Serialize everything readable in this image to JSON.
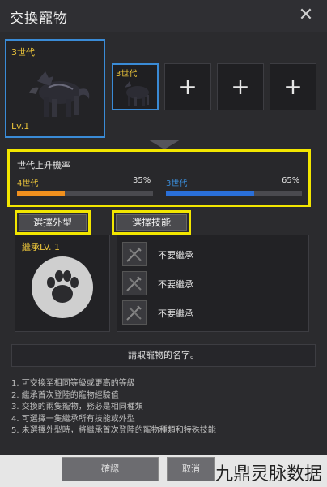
{
  "window": {
    "title": "交換寵物",
    "close_glyph": "✕"
  },
  "slots": {
    "main": {
      "generation": "3世代",
      "level": "Lv.1"
    },
    "secondary": {
      "generation": "3世代"
    },
    "add_glyph": "+"
  },
  "rate": {
    "title": "世代上升機率",
    "left": {
      "label": "4世代",
      "percent": "35%",
      "value": 35,
      "color": "#f0901e"
    },
    "right": {
      "label": "3世代",
      "percent": "65%",
      "value": 65,
      "color": "#2a6fd8"
    }
  },
  "buttons": {
    "appearance": "選擇外型",
    "skills": "選擇技能"
  },
  "inherit": {
    "level_label": "繼承LV. 1"
  },
  "skills": [
    {
      "text": "不要繼承",
      "icon": "sword-icon"
    },
    {
      "text": "不要繼承",
      "icon": "sword-icon"
    },
    {
      "text": "不要繼承",
      "icon": "sword-icon"
    }
  ],
  "name_field": {
    "placeholder": "請取寵物的名字。"
  },
  "notes": [
    "1. 可交換至相同等級或更高的等級",
    "2. 繼承首次登陸的寵物經驗值",
    "3. 交換的兩隻寵物，務必是相同種類",
    "4. 可選擇一隻繼承所有技能或外型",
    "5. 未選擇外型時，將繼承首次登陸的寵物種類和特殊技能"
  ],
  "footer": {
    "confirm": "確認",
    "cancel": "取消"
  },
  "watermark": "九鼎灵脉数据",
  "colors": {
    "accent_blue": "#3a8bd6",
    "highlight_yellow": "#f2e600",
    "gold_text": "#e8c23a"
  }
}
